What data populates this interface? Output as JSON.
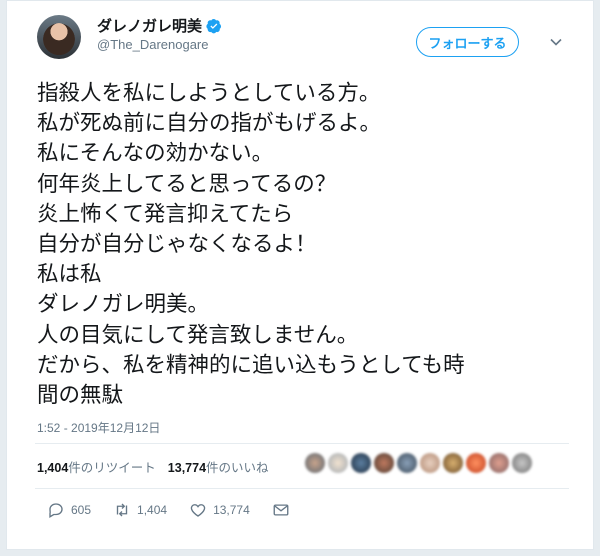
{
  "user": {
    "display_name": "ダレノガレ明美",
    "screen_name": "@The_Darenogare",
    "verified_icon": "verified-badge-icon"
  },
  "header": {
    "follow_label": "フォローする",
    "menu_icon": "chevron-down-icon"
  },
  "tweet": {
    "lines": [
      "指殺人を私にしようとしている方。",
      "私が死ぬ前に自分の指がもげるよ。",
      "私にそんなの効かない。",
      "何年炎上してると思ってるの？",
      "炎上怖くて発言抑えてたら",
      "自分が自分じゃなくなるよ！",
      "私は私",
      "ダレノガレ明美。",
      "人の目気にして発言致しません。",
      "だから、私を精神的に追い込もうとしても時",
      "間の無駄"
    ],
    "timestamp": "1:52 - 2019年12月12日"
  },
  "stats": {
    "retweets_count": "1,404",
    "retweets_label": "件のリツイート",
    "likes_count": "13,774",
    "likes_label": "件のいいね"
  },
  "liker_avatars_count": 10,
  "actions": {
    "reply_count": "605",
    "retweet_count": "1,404",
    "like_count": "13,774"
  },
  "colors": {
    "accent": "#1da1f2",
    "text": "#14171a",
    "secondary": "#657786"
  }
}
